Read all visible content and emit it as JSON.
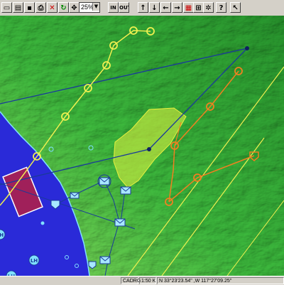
{
  "toolbar": {
    "zoom_value": "25%",
    "zoom_in_label": "IN",
    "zoom_out_label": "OUT"
  },
  "map": {
    "unit_labels": [
      "LH",
      "LH",
      "LH"
    ]
  },
  "statusbar": {
    "chart_type": "CADRG",
    "scale": "1:50 K",
    "coordinates": "N 33°23'23.54\" ,W 117°27'09.25\""
  },
  "colors": {
    "ocean": "#2a2ad8",
    "terrain": "#3cc83c",
    "yellow_route": "#f0f050",
    "orange_route": "#f08020",
    "blue_line": "#1a3a9a",
    "landing_zone": "#a0205a"
  }
}
